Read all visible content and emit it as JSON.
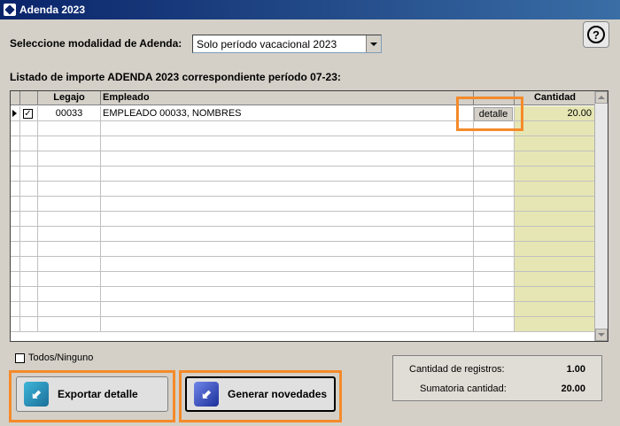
{
  "window": {
    "title": "Adenda 2023"
  },
  "modalidad": {
    "label": "Seleccione modalidad de Adenda:",
    "selected": "Solo período vacacional 2023"
  },
  "help": {
    "glyph": "?"
  },
  "listado": {
    "title": "Listado de importe ADENDA 2023 correspondiente período 07-23:"
  },
  "grid": {
    "columns": {
      "legajo": "Legajo",
      "empleado": "Empleado",
      "cantidad": "Cantidad"
    },
    "rows": [
      {
        "checked": true,
        "legajo": "00033",
        "empleado": "EMPLEADO 00033, NOMBRES",
        "detalle": "detalle",
        "cantidad": "20.00"
      }
    ],
    "empty_rows": 14,
    "check_glyph": "✓"
  },
  "todos": {
    "label": "Todos/Ninguno"
  },
  "buttons": {
    "exportar": "Exportar detalle",
    "generar": "Generar novedades"
  },
  "summary": {
    "registros_label": "Cantidad de registros:",
    "registros_value": "1.00",
    "sumatoria_label": "Sumatoria cantidad:",
    "sumatoria_value": "20.00"
  },
  "colors": {
    "highlight": "#f48a2a",
    "qty_column": "#e6e6b4",
    "title_bar": "#0a246a"
  }
}
